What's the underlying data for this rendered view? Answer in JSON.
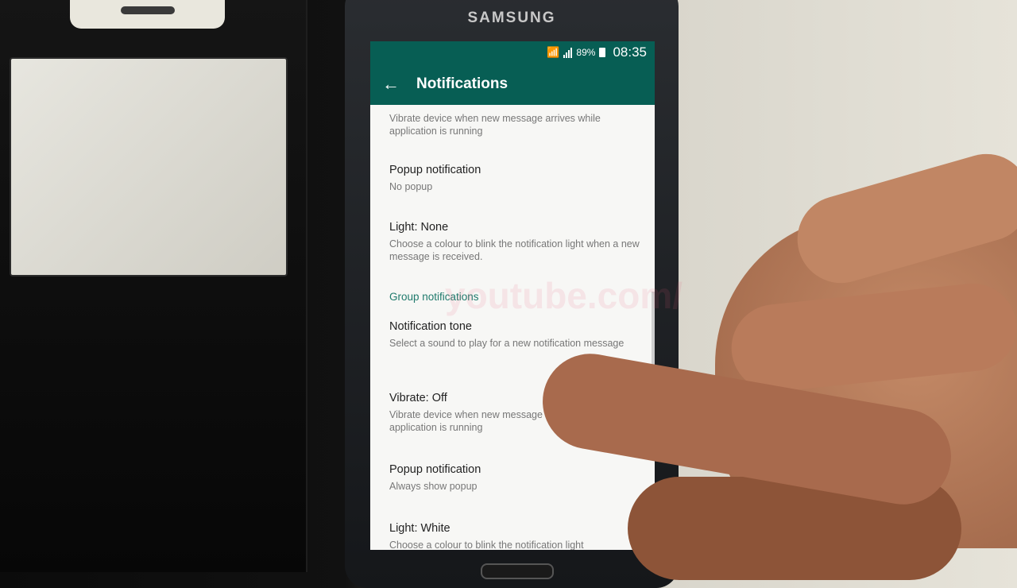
{
  "device": {
    "brand": "SAMSUNG"
  },
  "status_bar": {
    "battery": "89%",
    "time": "08:35"
  },
  "app_bar": {
    "title": "Notifications"
  },
  "partial_top_item": {
    "summary": "Vibrate device when new message arrives while application is running"
  },
  "message_items": [
    {
      "title": "Popup notification",
      "summary": "No popup"
    },
    {
      "title": "Light: None",
      "summary": "Choose a colour to blink the notification light when a new message is received."
    }
  ],
  "group_section": {
    "header": "Group notifications"
  },
  "group_items": [
    {
      "title": "Notification tone",
      "summary": "Select a sound to play for a new notification message"
    },
    {
      "title": "Vibrate: Off",
      "summary": "Vibrate device when new message arrives while application is running"
    },
    {
      "title": "Popup notification",
      "summary": "Always show popup"
    },
    {
      "title": "Light: White",
      "summary": "Choose a colour to blink the notification light"
    }
  ],
  "watermark": "youtube.com/"
}
